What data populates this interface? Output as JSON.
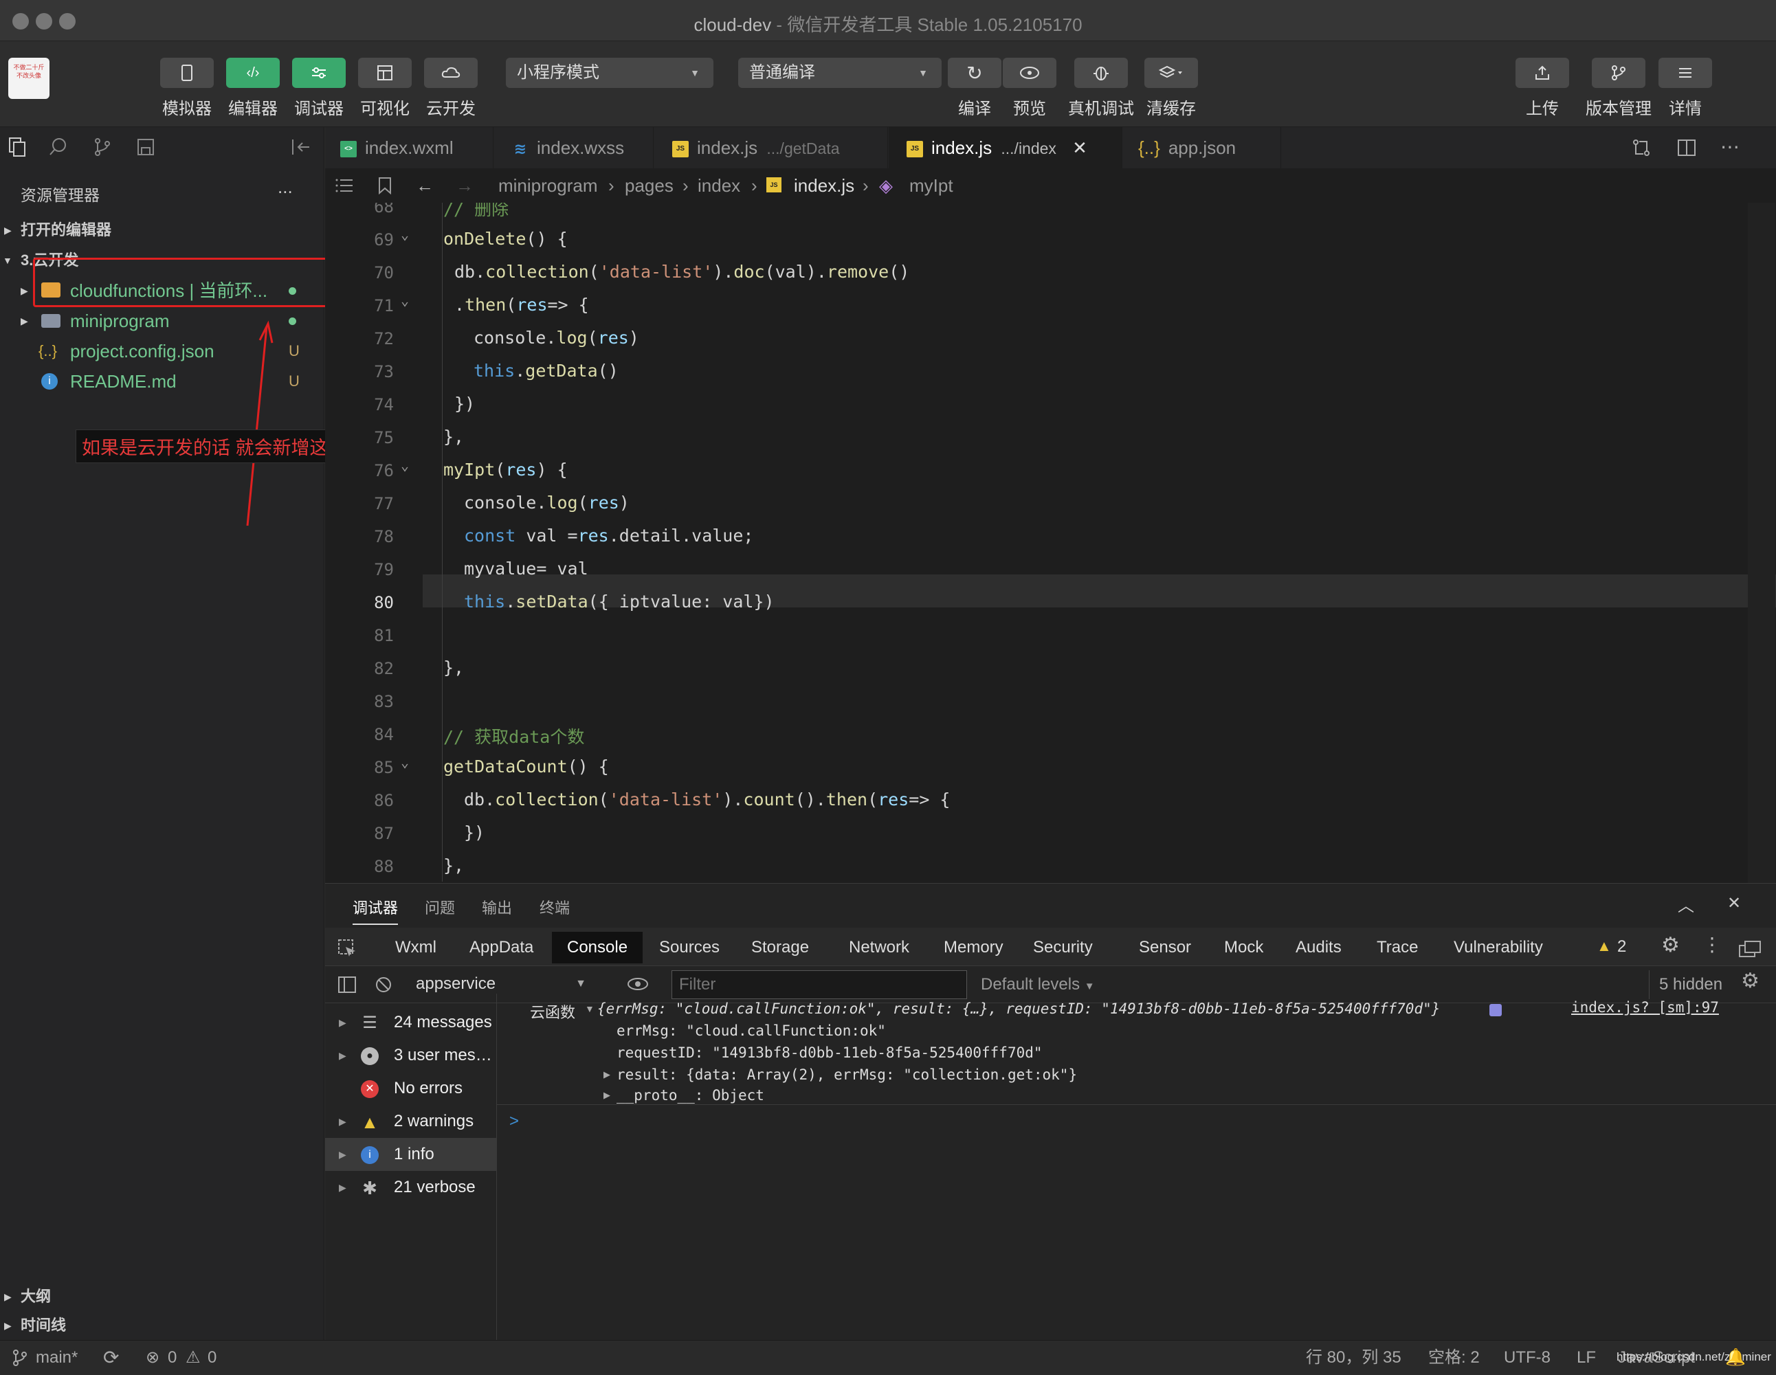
{
  "window": {
    "title": "cloud-dev",
    "subtitle": "微信开发者工具 Stable 1.05.2105170"
  },
  "avatar": {
    "line1": "不做二十斤",
    "line2": "不改头像"
  },
  "toolbar": {
    "simulator": "模拟器",
    "editor": "编辑器",
    "debugger": "调试器",
    "visual": "可视化",
    "cloud": "云开发",
    "mode": "小程序模式",
    "compile_mode": "普通编译",
    "compile": "编译",
    "preview": "预览",
    "remote_debug": "真机调试",
    "clear_cache": "清缓存",
    "upload": "上传",
    "version": "版本管理",
    "details": "详情"
  },
  "sidebar": {
    "title": "资源管理器",
    "more": "...",
    "open_editors": "打开的编辑器",
    "project": "3.云开发",
    "items": [
      {
        "name": "cloudfunctions | 当前环...",
        "status": ""
      },
      {
        "name": "miniprogram",
        "status": ""
      },
      {
        "name": "project.config.json",
        "status": "U"
      },
      {
        "name": "README.md",
        "status": "U"
      }
    ],
    "annotation": "如果是云开发的话 就会新增这个文件夹",
    "outline": "大纲",
    "timeline": "时间线"
  },
  "tabs": [
    {
      "label": "index.wxml",
      "hint": ""
    },
    {
      "label": "index.wxss",
      "hint": ""
    },
    {
      "label": "index.js",
      "hint": ".../getData"
    },
    {
      "label": "index.js",
      "hint": ".../index"
    },
    {
      "label": "app.json",
      "hint": ""
    }
  ],
  "breadcrumb": [
    "miniprogram",
    "pages",
    "index",
    "index.js",
    "myIpt"
  ],
  "code_lines": [
    {
      "n": "68",
      "t": "// 删除"
    },
    {
      "n": "69",
      "t": "onDelete() {"
    },
    {
      "n": "70",
      "t": "db.collection('data-list').doc(val).remove()"
    },
    {
      "n": "71",
      "t": ".then(res=> {"
    },
    {
      "n": "72",
      "t": "console.log(res)"
    },
    {
      "n": "73",
      "t": "this.getData()"
    },
    {
      "n": "74",
      "t": "})"
    },
    {
      "n": "75",
      "t": "},"
    },
    {
      "n": "76",
      "t": "myIpt(res) {"
    },
    {
      "n": "77",
      "t": "console.log(res)"
    },
    {
      "n": "78",
      "t": "const val =res.detail.value;"
    },
    {
      "n": "79",
      "t": "myvalue= val"
    },
    {
      "n": "80",
      "t": "this.setData({ iptvalue: val})"
    },
    {
      "n": "81",
      "t": ""
    },
    {
      "n": "82",
      "t": "},"
    },
    {
      "n": "83",
      "t": ""
    },
    {
      "n": "84",
      "t": "// 获取data个数"
    },
    {
      "n": "85",
      "t": "getDataCount() {"
    },
    {
      "n": "86",
      "t": "db.collection('data-list').count().then(res=> {"
    },
    {
      "n": "87",
      "t": "})"
    },
    {
      "n": "88",
      "t": "},"
    }
  ],
  "panel": {
    "tabs": [
      "调试器",
      "问题",
      "输出",
      "终端"
    ],
    "devtools_tabs": [
      "Wxml",
      "AppData",
      "Console",
      "Sources",
      "Storage",
      "Network",
      "Memory",
      "Security",
      "Sensor",
      "Mock",
      "Audits",
      "Trace",
      "Vulnerability"
    ],
    "warn_count": "2",
    "context": "appservice",
    "filter_placeholder": "Filter",
    "levels": "Default levels",
    "hidden": "5 hidden",
    "groups": [
      {
        "label": "24 messages"
      },
      {
        "label": "3 user mes…"
      },
      {
        "label": "No errors"
      },
      {
        "label": "2 warnings"
      },
      {
        "label": "1 info"
      },
      {
        "label": "21 verbose"
      }
    ],
    "log": {
      "prefix": "云函数",
      "summary": "{errMsg: \"cloud.callFunction:ok\", result: {…}, requestID: \"14913bf8-d0bb-11eb-8f5a-525400fff70d\"}",
      "source": "index.js? [sm]:97",
      "lines": [
        "errMsg: \"cloud.callFunction:ok\"",
        "requestID: \"14913bf8-d0bb-11eb-8f5a-525400fff70d\"",
        "result: {data: Array(2), errMsg: \"collection.get:ok\"}",
        "__proto__: Object"
      ],
      "prompt": ">"
    }
  },
  "status": {
    "branch": "main*",
    "errors": "0",
    "warnings": "0",
    "position": "行 80，列 35",
    "spaces": "空格: 2",
    "encoding": "UTF-8",
    "eol": "LF",
    "language": "JavaScript",
    "watermark": "https://blog.csdn.net/zzzminer"
  }
}
